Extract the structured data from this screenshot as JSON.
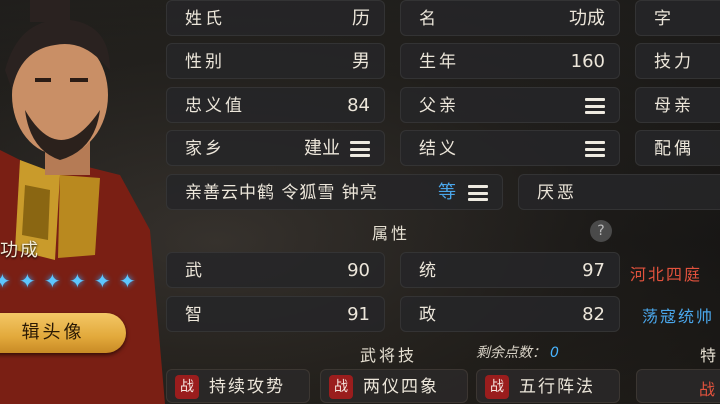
{
  "hero": {
    "name": "历功成",
    "name_visible": "功成",
    "edit_button": "辑头像",
    "star_count": 6
  },
  "fields": {
    "surname_label": "姓氏",
    "surname_value": "历",
    "given_label": "名",
    "given_value": "功成",
    "courtesy_label": "字",
    "gender_label": "性别",
    "gender_value": "男",
    "birth_label": "生年",
    "birth_value": "160",
    "skill_label": "技力",
    "loyalty_label": "忠义值",
    "loyalty_value": "84",
    "father_label": "父亲",
    "mother_label": "母亲",
    "hometown_label": "家乡",
    "hometown_value": "建业",
    "sworn_label": "结义",
    "spouse_label": "配偶",
    "likes_text": "亲善云中鹤 令狐雪 钟亮",
    "likes_more": "等",
    "dislikes_label": "厌恶"
  },
  "attributes": {
    "title": "属性",
    "help": "?",
    "war_label": "武",
    "war_value": "90",
    "lead_label": "统",
    "lead_value": "97",
    "int_label": "智",
    "int_value": "91",
    "pol_label": "政",
    "pol_value": "82"
  },
  "skills": {
    "title": "武将技",
    "remaining_label": "剩余点数：",
    "remaining_value": "0",
    "tag": "战",
    "items": [
      "持续攻势",
      "两仪四象",
      "五行阵法"
    ]
  },
  "right_panel": {
    "red_text": "河北四庭",
    "blue_text": "荡寇统帅",
    "special_title": "特",
    "partial_red": "战"
  },
  "colors": {
    "accent_blue": "#4aa6ea",
    "accent_red": "#e2523d",
    "button_gold": "#e2a93b"
  }
}
